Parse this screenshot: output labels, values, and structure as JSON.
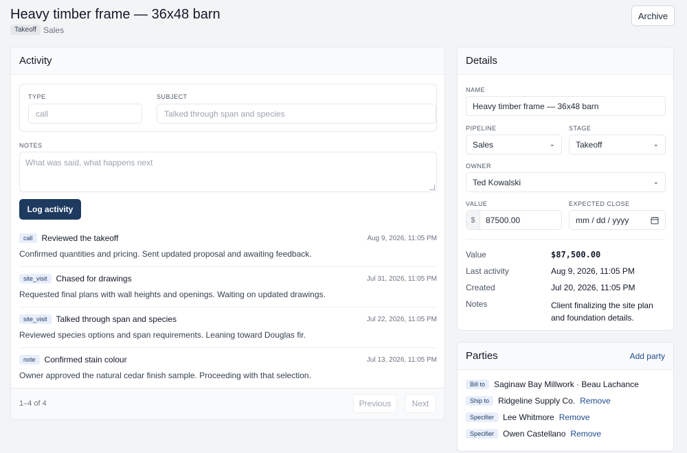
{
  "header": {
    "title": "Heavy timber frame — 36x48 barn",
    "stage_badge": "Takeoff",
    "pipeline": "Sales",
    "archive_label": "Archive"
  },
  "activity": {
    "title": "Activity",
    "form": {
      "type_label": "TYPE",
      "type_placeholder": "call",
      "subject_label": "SUBJECT",
      "subject_placeholder": "Talked through span and species",
      "notes_label": "NOTES",
      "notes_placeholder": "What was said, what happens next",
      "submit_label": "Log activity"
    },
    "items": [
      {
        "type": "call",
        "subject": "Reviewed the takeoff",
        "time": "Aug 9, 2026, 11:05 PM",
        "text": "Confirmed quantities and pricing. Sent updated proposal and awaiting feedback."
      },
      {
        "type": "site_visit",
        "subject": "Chased for drawings",
        "time": "Jul 31, 2026, 11:05 PM",
        "text": "Requested final plans with wall heights and openings. Waiting on updated drawings."
      },
      {
        "type": "site_visit",
        "subject": "Talked through span and species",
        "time": "Jul 22, 2026, 11:05 PM",
        "text": "Reviewed species options and span requirements. Leaning toward Douglas fir."
      },
      {
        "type": "note",
        "subject": "Confirmed stain colour",
        "time": "Jul 13, 2026, 11:05 PM",
        "text": "Owner approved the natural cedar finish sample. Proceeding with that selection."
      }
    ],
    "pager": {
      "count": "1–4 of 4",
      "previous": "Previous",
      "next": "Next"
    }
  },
  "details": {
    "title": "Details",
    "name_label": "NAME",
    "name_value": "Heavy timber frame — 36x48 barn",
    "pipeline_label": "PIPELINE",
    "pipeline_value": "Sales",
    "stage_label": "STAGE",
    "stage_value": "Takeoff",
    "owner_label": "OWNER",
    "owner_value": "Ted Kowalski",
    "value_label": "VALUE",
    "currency": "$",
    "value_value": "87500.00",
    "close_label": "EXPECTED CLOSE",
    "close_placeholder": "mm / dd / yyyy",
    "summary": [
      {
        "key": "Value",
        "value": "$87,500.00"
      },
      {
        "key": "Last activity",
        "value": "Aug 9, 2026, 11:05 PM"
      },
      {
        "key": "Created",
        "value": "Jul 20, 2026, 11:05 PM"
      },
      {
        "key": "Notes",
        "value": "Client finalizing the site plan and foundation details."
      }
    ]
  },
  "parties": {
    "title": "Parties",
    "add_label": "Add party",
    "remove_label": "Remove",
    "items": [
      {
        "role": "Bill to",
        "name": "Saginaw Bay Millwork · Beau Lachance"
      },
      {
        "role": "Ship to",
        "name": "Ridgeline Supply Co."
      },
      {
        "role": "Specifier",
        "name": "Lee Whitmore"
      },
      {
        "role": "Specifier",
        "name": "Owen Castellano"
      }
    ]
  }
}
